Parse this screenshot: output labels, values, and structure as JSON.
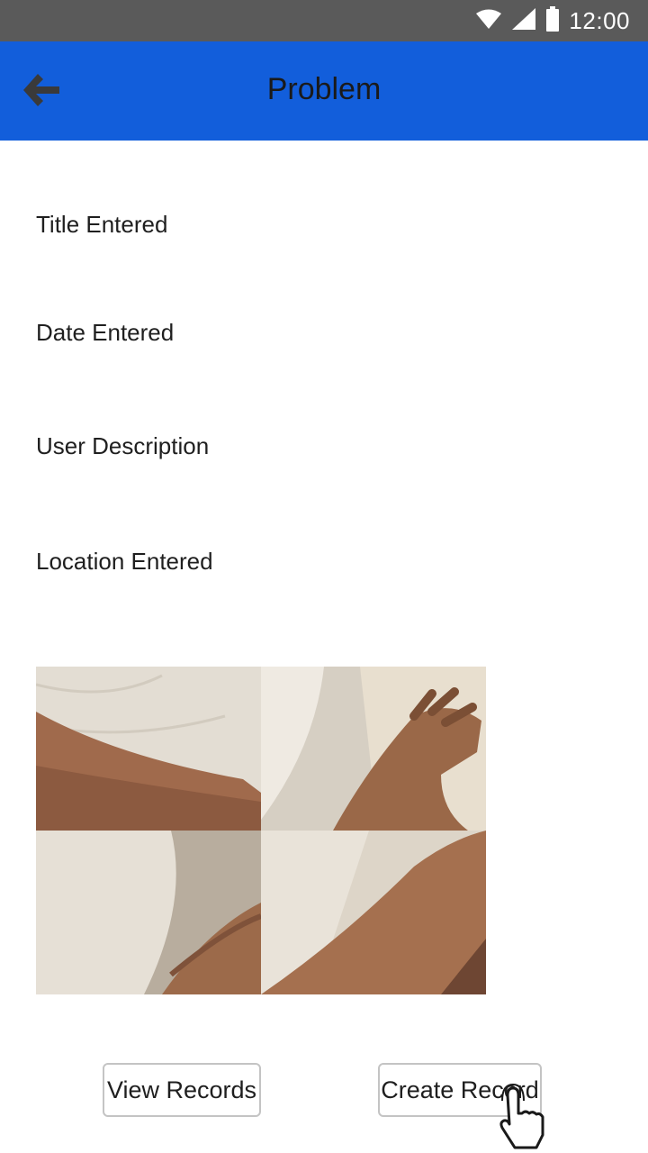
{
  "status_bar": {
    "time": "12:00",
    "icons": [
      "wifi-icon",
      "signal-icon",
      "battery-icon"
    ]
  },
  "app_bar": {
    "title": "Problem",
    "back_icon": "arrow-left-icon"
  },
  "fields": {
    "title": "Title Entered",
    "date": "Date Entered",
    "description": "User Description",
    "location": "Location Entered"
  },
  "gallery": {
    "photo_count": 4
  },
  "actions": {
    "view_label": "View Records",
    "create_label": "Create Record"
  },
  "colors": {
    "status_bar": "#5a5a5a",
    "app_bar": "#125edb"
  }
}
